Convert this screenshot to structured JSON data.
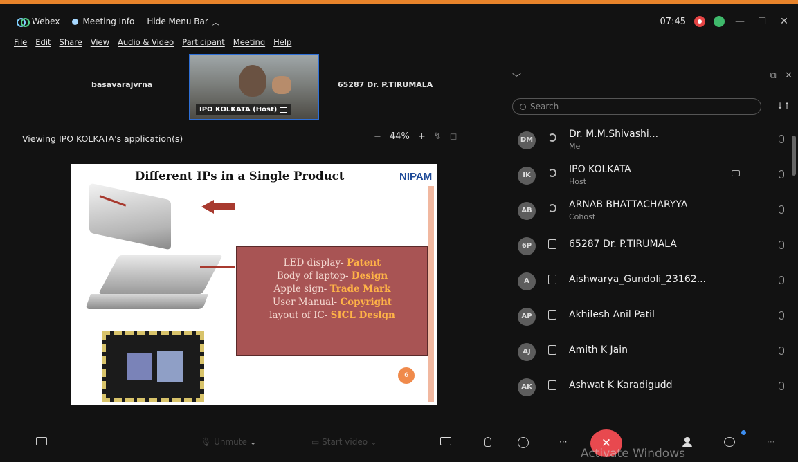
{
  "title_bar": {
    "app_name": "Webex",
    "meeting_info": "Meeting Info",
    "hide_menu": "Hide Menu Bar",
    "clock": "07:45"
  },
  "menu": [
    "File",
    "Edit",
    "Share",
    "View",
    "Audio & Video",
    "Participant",
    "Meeting",
    "Help"
  ],
  "video_strip": {
    "left_name": "basavarajvrna",
    "host_name": "IPO KOLKATA (Host)",
    "right_name": "65287 Dr. P.TIRUMALA"
  },
  "viewing": {
    "label": "Viewing IPO KOLKATA's application(s)",
    "zoom_minus": "−",
    "zoom_value": "44%",
    "zoom_plus": "+"
  },
  "slide": {
    "title": "Different IPs in a Single Product",
    "logo": "NIPAM",
    "lines": [
      {
        "text": "LED display- ",
        "ip": "Patent"
      },
      {
        "text": "Body of laptop- ",
        "ip": "Design"
      },
      {
        "text": "Apple sign- ",
        "ip": "Trade Mark"
      },
      {
        "text": "User Manual- ",
        "ip": "Copyright"
      },
      {
        "text": "layout of IC- ",
        "ip": "SICL Design"
      }
    ],
    "page_number": "6"
  },
  "panel": {
    "search_placeholder": "Search",
    "participants": [
      {
        "initials": "DM",
        "name": "Dr. M.M.Shivashi...",
        "role": "Me"
      },
      {
        "initials": "IK",
        "name": "IPO KOLKATA",
        "role": "Host"
      },
      {
        "initials": "AB",
        "name": "ARNAB BHATTACHARYYA",
        "role": "Cohost"
      },
      {
        "initials": "6P",
        "name": "65287 Dr. P.TIRUMALA",
        "role": ""
      },
      {
        "initials": "A",
        "name": "Aishwarya_Gundoli_23162...",
        "role": ""
      },
      {
        "initials": "AP",
        "name": "Akhilesh Anil Patil",
        "role": ""
      },
      {
        "initials": "AJ",
        "name": "Amith K Jain",
        "role": ""
      },
      {
        "initials": "AK",
        "name": "Ashwat K Karadigudd",
        "role": ""
      }
    ]
  },
  "bottom": {
    "mute_label": "Unmute",
    "video_label": "Start video",
    "watermark": "Activate Windows"
  },
  "colors": {
    "accent_orange": "#e8832a",
    "end_red": "#e8494f",
    "slide_box": "#a85454"
  }
}
